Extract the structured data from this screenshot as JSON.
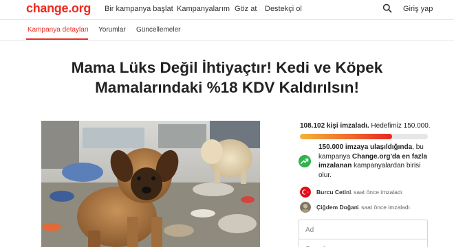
{
  "header": {
    "logo": "change.org",
    "nav": [
      "Bir kampanya başlat",
      "Kampanyalarım",
      "Göz at",
      "Destekçi ol"
    ],
    "login": "Giriş yap"
  },
  "tabs": [
    "Kampanya detayları",
    "Yorumlar",
    "Güncellemeler"
  ],
  "petition": {
    "title": "Mama Lüks Değil İhtiyaçtır! Kedi ve Köpek Mamalarındaki %18 KDV Kaldırılsın!"
  },
  "stats": {
    "signed_count": "108.102 kişi imzaladı.",
    "goal_text": "Hedefimiz 150.000.",
    "progress_fraction": 0.72
  },
  "goal_message": {
    "part1": "150.000 imzaya ulaşıldığında",
    "part2": ", bu kampanya ",
    "part3": "Change.org'da en fazla imzalanan",
    "part4": " kampanyalardan birisi olur."
  },
  "recent_signers": [
    {
      "name": "Burcu Cetin",
      "time": "1 saat önce imzaladı"
    },
    {
      "name": "Çiğdem Doğan",
      "time": "1 saat önce imzaladı"
    }
  ],
  "form": {
    "first_name_placeholder": "Ad",
    "last_name_placeholder": "Soyadı"
  },
  "colors": {
    "brand": "#ec2c22",
    "trend_green": "#2fb44a"
  },
  "icons": {
    "search": "search-icon",
    "trend": "trending-up-icon"
  }
}
